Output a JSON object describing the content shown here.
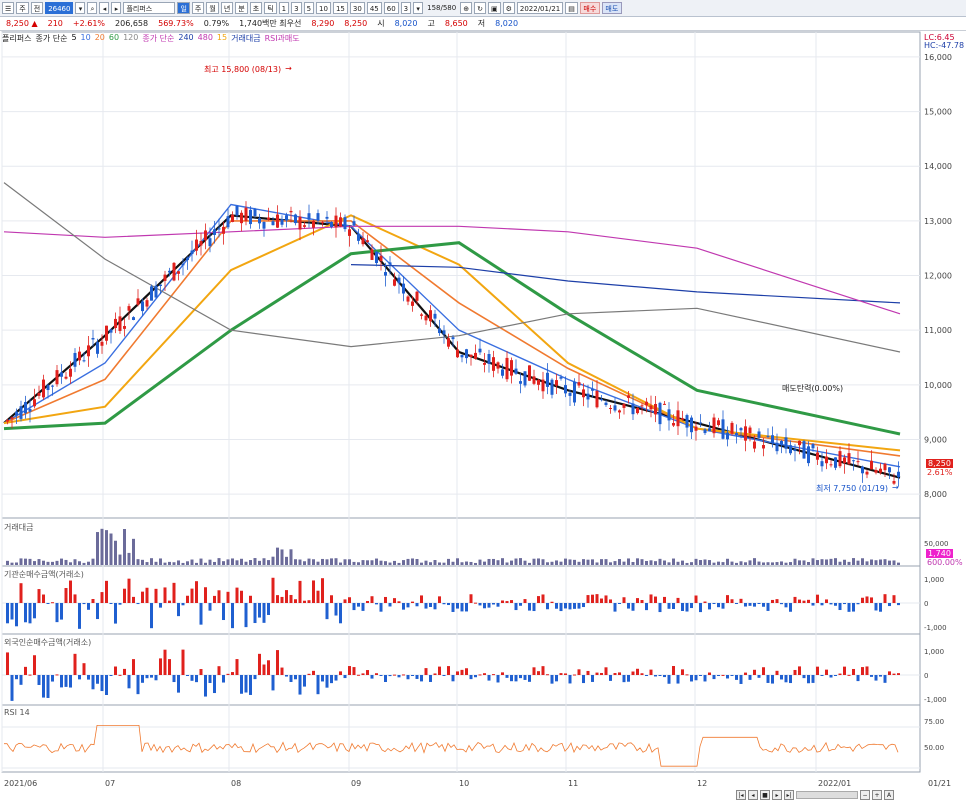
{
  "toolbar": {
    "items_left": [
      "주",
      "전"
    ],
    "code": "26460",
    "name": "플리퍼스",
    "periods": [
      "일",
      "주",
      "월",
      "년",
      "분",
      "초",
      "틱"
    ],
    "minutes": [
      "1",
      "3",
      "5",
      "10",
      "15",
      "30",
      "45",
      "60"
    ],
    "count": "3",
    "range": "158/580",
    "date": "2022/01/21",
    "buy_label": "매수",
    "sell_label": "매도"
  },
  "quote": {
    "price": "8,250",
    "change": "210",
    "change_pct": "+2.61%",
    "volume": "206,658",
    "vol_pct": "569.73%",
    "turnover": "0.79%",
    "amount": "1,740백만",
    "best_bid_label": "최우선",
    "best_ask": "8,290",
    "best_bid": "8,250",
    "open_label": "시",
    "open": "8,020",
    "high_label": "고",
    "high": "8,650",
    "low_label": "저",
    "low": "8,020"
  },
  "legend_main": {
    "name": "플리퍼스",
    "ma_short_label": "종가 단순",
    "ma_short_periods": [
      "5",
      "10",
      "20",
      "60",
      "120"
    ],
    "ma_long_label": "종가 단순",
    "ma_long_periods": [
      "240",
      "480",
      "15"
    ],
    "volume_label": "거래대금",
    "rsi_label": "RSI과매도"
  },
  "price_axis": {
    "ticks": [
      "16,000",
      "15,000",
      "14,000",
      "13,000",
      "12,000",
      "11,000",
      "10,000",
      "9,000",
      "8,000"
    ],
    "lc": "LC:6.45",
    "hc": "HC:-47.78",
    "current": "8,250",
    "current_pct": "2.61%"
  },
  "annotations": {
    "high": "최고 15,800 (08/13)",
    "low": "최저 7,750 (01/19)",
    "signal": "매도탄력(0.00%)"
  },
  "panels": {
    "volume": {
      "title": "거래대금",
      "ticks": [
        "50,000"
      ],
      "current": "1,740",
      "pct": "600.00%"
    },
    "inst": {
      "title": "기관순매수금액(거래소)",
      "ticks": [
        "1,000",
        "0",
        "-1,000"
      ]
    },
    "foreign": {
      "title": "외국인순매수금액(거래소)",
      "ticks": [
        "1,000",
        "0",
        "-1,000"
      ]
    },
    "rsi": {
      "title": "RSI 14",
      "ticks": [
        "75.00",
        "50.00"
      ]
    }
  },
  "x_axis": [
    "2021/06",
    "07",
    "08",
    "09",
    "10",
    "11",
    "12",
    "2022/01",
    "01/21"
  ],
  "colors": {
    "up": "#e0211d",
    "down": "#1f5fd0",
    "ma5": "#111111",
    "ma10": "#3a6fe0",
    "ma20": "#f07a30",
    "ma60": "#f2a611",
    "ma120": "#2f9a45",
    "ma240": "#1d3fa8",
    "ma480": "#c038b0",
    "ma_extra": "#7a7a7a"
  },
  "chart_data": {
    "type": "line",
    "title": "",
    "xlabel": "",
    "ylabel": "",
    "ylim": [
      7600,
      16200
    ],
    "x": [
      "2021-06",
      "2021-07",
      "2021-08",
      "2021-09",
      "2021-10",
      "2021-11",
      "2021-12",
      "2022-01"
    ],
    "series": [
      {
        "name": "5",
        "values": [
          9300,
          10900,
          13100,
          12900,
          10600,
          9900,
          9300,
          8300
        ]
      },
      {
        "name": "10",
        "values": [
          9300,
          10400,
          13300,
          12900,
          11000,
          10100,
          9200,
          8500
        ]
      },
      {
        "name": "20",
        "values": [
          9300,
          10100,
          13000,
          13000,
          11500,
          10300,
          9200,
          8700
        ]
      },
      {
        "name": "60",
        "values": [
          9300,
          9600,
          12100,
          13100,
          12200,
          10400,
          9200,
          8800
        ]
      },
      {
        "name": "120",
        "values": [
          9200,
          9300,
          11000,
          12400,
          12600,
          11300,
          9900,
          9100
        ]
      },
      {
        "name": "240",
        "values": [
          null,
          null,
          null,
          12200,
          12150,
          11900,
          11700,
          11500
        ]
      },
      {
        "name": "480",
        "values": [
          12800,
          12700,
          12800,
          12900,
          12900,
          12800,
          12500,
          11300
        ]
      },
      {
        "name": "15",
        "values": [
          13700,
          12300,
          11000,
          10700,
          10900,
          11300,
          11400,
          10600
        ]
      }
    ]
  }
}
